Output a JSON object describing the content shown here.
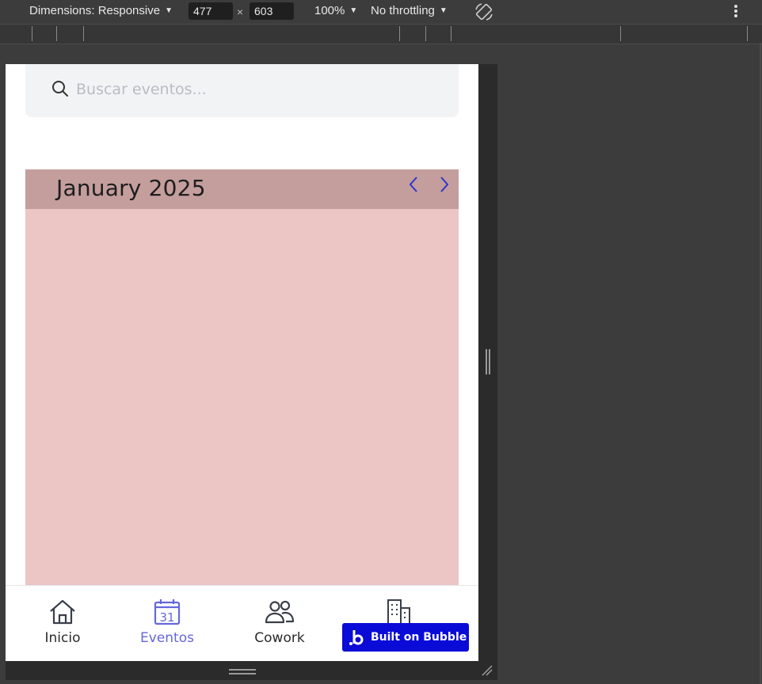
{
  "devtools": {
    "dimensions_label": "Dimensions: Responsive",
    "width_value": "477",
    "height_value": "603",
    "zoom": "100%",
    "throttling": "No throttling",
    "times": "×",
    "caret": "▼"
  },
  "search": {
    "placeholder": "Buscar eventos..."
  },
  "calendar": {
    "month_title": "January 2025",
    "header_color": "#c49e9d",
    "body_color": "#ecc5c5",
    "nav_color": "#2f35c8"
  },
  "bottom_nav": {
    "items": [
      {
        "label": "Inicio",
        "icon": "home-icon"
      },
      {
        "label": "Eventos",
        "icon": "calendar-icon",
        "day": "31",
        "active": true
      },
      {
        "label": "Cowork",
        "icon": "users-icon"
      },
      {
        "label": "",
        "icon": "building-icon"
      }
    ],
    "active_color": "#6667d9"
  },
  "badge": {
    "text": "Built on Bubble",
    "color": "#0b0bd8"
  }
}
